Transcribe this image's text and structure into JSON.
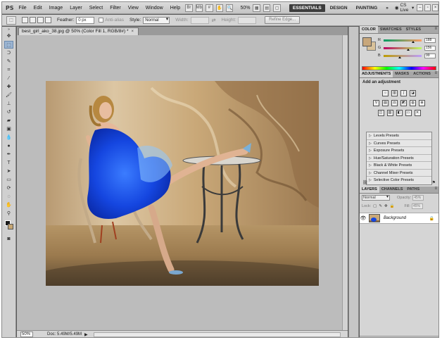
{
  "app": {
    "logo": "PS"
  },
  "menu": [
    "File",
    "Edit",
    "Image",
    "Layer",
    "Select",
    "Filter",
    "View",
    "Window",
    "Help"
  ],
  "menubar": {
    "zoom": "50%",
    "workspaces": [
      "ESSENTIALS",
      "DESIGN",
      "PAINTING"
    ],
    "more": "»",
    "cslive": "CS Live"
  },
  "options": {
    "feather_label": "Feather:",
    "feather_value": "0 px",
    "antialias_label": "Anti-alias",
    "style_label": "Style:",
    "style_value": "Normal",
    "width_label": "Width:",
    "height_label": "Height:",
    "refine_label": "Refine Edge..."
  },
  "document": {
    "tab_title": "best_girl_ako_38.jpg @ 50% (Color Fill 1, RGB/8#) *",
    "tab_close": "×",
    "zoom": "50%",
    "doc_info": "Doc: 5.49M/5.49M",
    "status_arrow": "▶"
  },
  "color_panel": {
    "tabs": [
      "COLOR",
      "SWATCHES",
      "STYLES"
    ],
    "channels": [
      {
        "label": "R",
        "value": "188",
        "position": 0.74
      },
      {
        "label": "G",
        "value": "156",
        "position": 0.61
      },
      {
        "label": "B",
        "value": "99",
        "position": 0.39
      }
    ],
    "colors": {
      "foreground": "#c8a77b",
      "background": "#d9c29a"
    }
  },
  "adjustments_panel": {
    "tabs": [
      "ADJUSTMENTS",
      "MASKS",
      "ACTIONS"
    ],
    "title": "Add an adjustment",
    "presets": [
      "Levels Presets",
      "Curves Presets",
      "Exposure Presets",
      "Hue/Saturation Presets",
      "Black & White Presets",
      "Channel Mixer Presets",
      "Selective Color Presets"
    ]
  },
  "layers_panel": {
    "tabs": [
      "LAYERS",
      "CHANNELS",
      "PATHS"
    ],
    "blend_mode": "Normal",
    "opacity_label": "Opacity:",
    "opacity_value": "45%",
    "lock_label": "Lock:",
    "fill_label": "Fill:",
    "fill_value": "45%",
    "layers": [
      {
        "name": "Background",
        "visible": true,
        "locked": true
      }
    ]
  }
}
